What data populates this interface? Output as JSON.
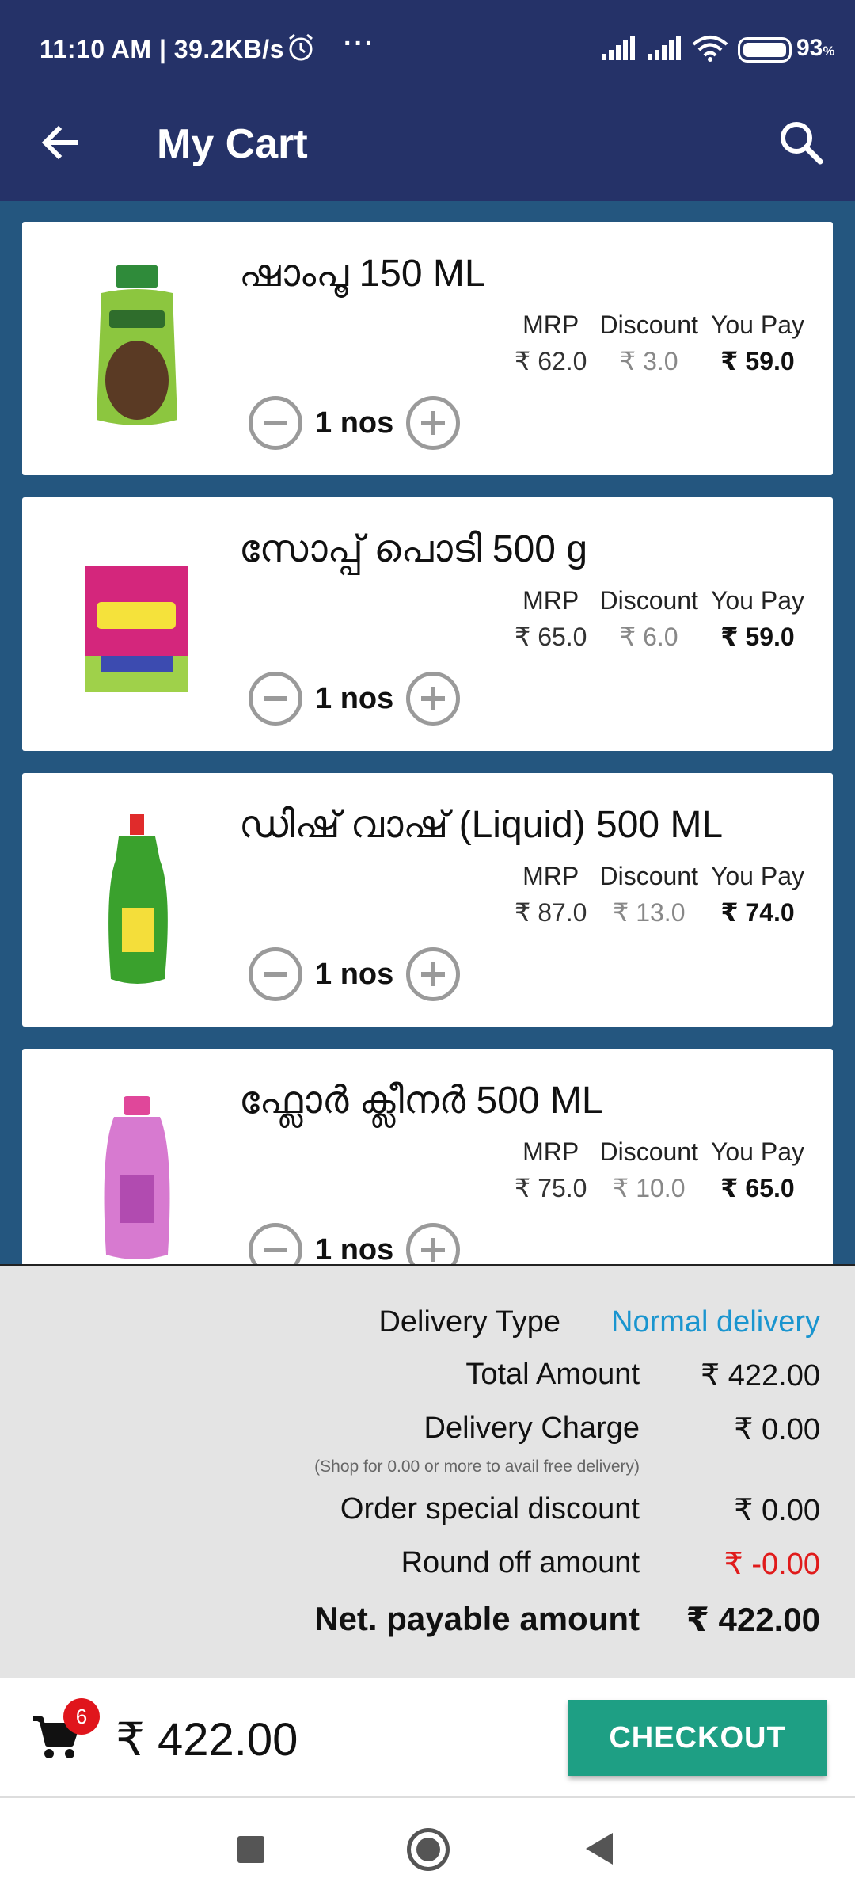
{
  "status_bar": {
    "time": "11:10 AM | 39.2KB/s",
    "more": "···",
    "battery": "93",
    "battery_unit": "%"
  },
  "app_bar": {
    "title": "My Cart"
  },
  "price_headers": {
    "mrp": "MRP",
    "discount": "Discount",
    "you_pay": "You Pay"
  },
  "items": [
    {
      "name": "ഷാംപൂ 150 ML",
      "mrp": "₹ 62.0",
      "discount": "₹ 3.0",
      "you_pay": "₹ 59.0",
      "qty": "1 nos",
      "color": "#7bbf2a"
    },
    {
      "name": "സോപ്പ് പൊടി 500 g",
      "mrp": "₹ 65.0",
      "discount": "₹ 6.0",
      "you_pay": "₹ 59.0",
      "qty": "1 nos",
      "color": "#d4267c"
    },
    {
      "name": "ഡിഷ് വാഷ് (Liquid) 500 ML",
      "mrp": "₹ 87.0",
      "discount": "₹ 13.0",
      "you_pay": "₹ 74.0",
      "qty": "1 nos",
      "color": "#3aa12d"
    },
    {
      "name": "ഫ്ലോർ ക്ലീനർ 500 ML",
      "mrp": "₹ 75.0",
      "discount": "₹ 10.0",
      "you_pay": "₹ 65.0",
      "qty": "1 nos",
      "color": "#d77ad0"
    }
  ],
  "summary": {
    "delivery_type_label": "Delivery Type",
    "delivery_type_value": "Normal delivery",
    "total_amount_label": "Total Amount",
    "total_amount_value": "₹ 422.00",
    "delivery_charge_label": "Delivery Charge",
    "delivery_charge_value": "₹ 0.00",
    "delivery_note": "(Shop for 0.00 or more to avail free delivery)",
    "special_discount_label": "Order special discount",
    "special_discount_value": "₹ 0.00",
    "round_off_label": "Round off amount",
    "round_off_value": "₹ -0.00",
    "net_payable_label": "Net. payable amount",
    "net_payable_value": "₹ 422.00"
  },
  "bottom_bar": {
    "cart_count": "6",
    "total": "₹ 422.00",
    "checkout_label": "CHECKOUT"
  },
  "colors": {
    "header": "#253268",
    "list_bg": "#24567f",
    "checkout": "#1e9f84",
    "link": "#1a95cf",
    "negative": "#e01b1b",
    "badge": "#e0151c"
  }
}
